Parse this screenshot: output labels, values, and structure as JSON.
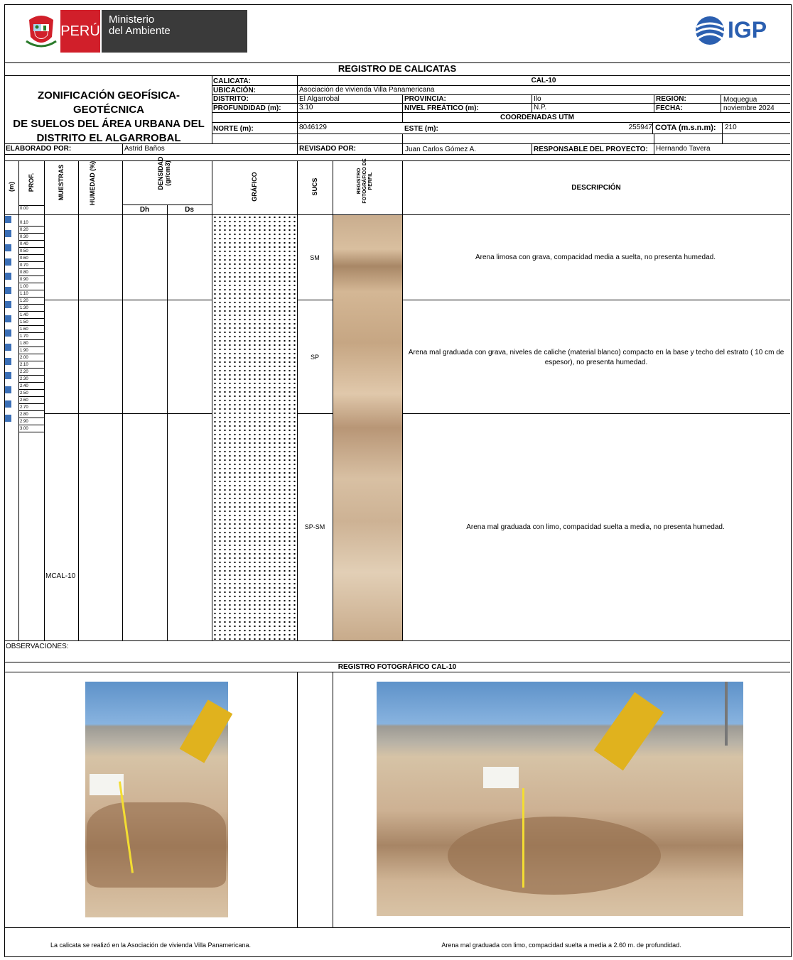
{
  "header": {
    "peru_label": "PERÚ",
    "ministerio_line1": "Ministerio",
    "ministerio_line2": "del Ambiente",
    "igp_label": "IGP"
  },
  "title_bar": "REGISTRO DE CALICATAS",
  "project_title": [
    "ZONIFICACIÓN GEOFÍSICA-GEOTÉCNICA",
    "DE SUELOS DEL ÁREA URBANA DEL",
    "DISTRITO EL ALGARROBAL"
  ],
  "info": {
    "calicata_label": "CALICATA:",
    "calicata_value": "CAL-10",
    "ubicacion_label": "UBICACIÓN:",
    "ubicacion_value": "Asociación de vivienda Villa Panamericana",
    "distrito_label": "DISTRITO:",
    "distrito_value": "El Algarrobal",
    "provincia_label": "PROVINCIA:",
    "provincia_value": "Ilo",
    "region_label": "REGIÓN:",
    "region_value": "Moquegua",
    "profundidad_label": "PROFUNDIDAD (m):",
    "profundidad_value": "3.10",
    "nivel_label": "NIVEL FREÁTICO (m):",
    "nivel_value": "N.P.",
    "fecha_label": "FECHA:",
    "fecha_value": "noviembre 2024",
    "coordenadas_label": "COORDENADAS UTM",
    "norte_label": "NORTE (m):",
    "norte_value": "8046129",
    "este_label": "ESTE (m):",
    "este_value": "255947",
    "cota_label": "COTA (m.s.n.m):",
    "cota_value": "210",
    "elaborado_label": "ELABORADO POR:",
    "elaborado_value": "Astrid Baños",
    "revisado_label": "REVISADO POR:",
    "revisado_value": "Juan Carlos Gómez A.",
    "responsable_label": "RESPONSABLE DEL PROYECTO:",
    "responsable_value": "Hernando Tavera"
  },
  "columns": {
    "m": "(m)",
    "prof": "PROF.",
    "muestras": "MUESTRAS",
    "humedad": "HUMEDAD (%)",
    "densidad": "DENSIDAD (gr/cm3)",
    "dh": "Dh",
    "ds": "Ds",
    "grafico": "GRÁFICO",
    "sucs": "SUCS",
    "registro": "REGISTRO FOTOGRÁFICO DE PERFIL",
    "descripcion": "DESCRIPCIÓN"
  },
  "depths": [
    "0.00",
    "0.10",
    "0.20",
    "0.30",
    "0.40",
    "0.50",
    "0.60",
    "0.70",
    "0.80",
    "0.90",
    "1.00",
    "1.10",
    "1.20",
    "1.30",
    "1.40",
    "1.50",
    "1.60",
    "1.70",
    "1.80",
    "1.90",
    "2.00",
    "2.10",
    "2.20",
    "2.30",
    "2.40",
    "2.50",
    "2.60",
    "2.70",
    "2.80",
    "2.90",
    "3.00"
  ],
  "layers": [
    {
      "sucs": "SM",
      "description": "Arena limosa con grava, compacidad media a suelta, no presenta humedad."
    },
    {
      "sucs": "SP",
      "description": "Arena mal graduada con grava, niveles de caliche (material blanco) compacto en la base y techo del estrato ( 10 cm de espesor), no presenta humedad."
    },
    {
      "sucs": "SP-SM",
      "description": "Arena mal graduada con limo, compacidad suelta a media, no presenta humedad."
    }
  ],
  "sample": "MCAL-10",
  "observaciones": "OBSERVACIONES:",
  "photo_title": "REGISTRO FOTOGRÁFICO CAL-10",
  "captions": [
    "La calicata se realizó en la Asociación de vivienda Villa Panamericana.",
    "Arena mal graduada con limo, compacidad suelta a media a 2.60 m. de profundidad."
  ]
}
